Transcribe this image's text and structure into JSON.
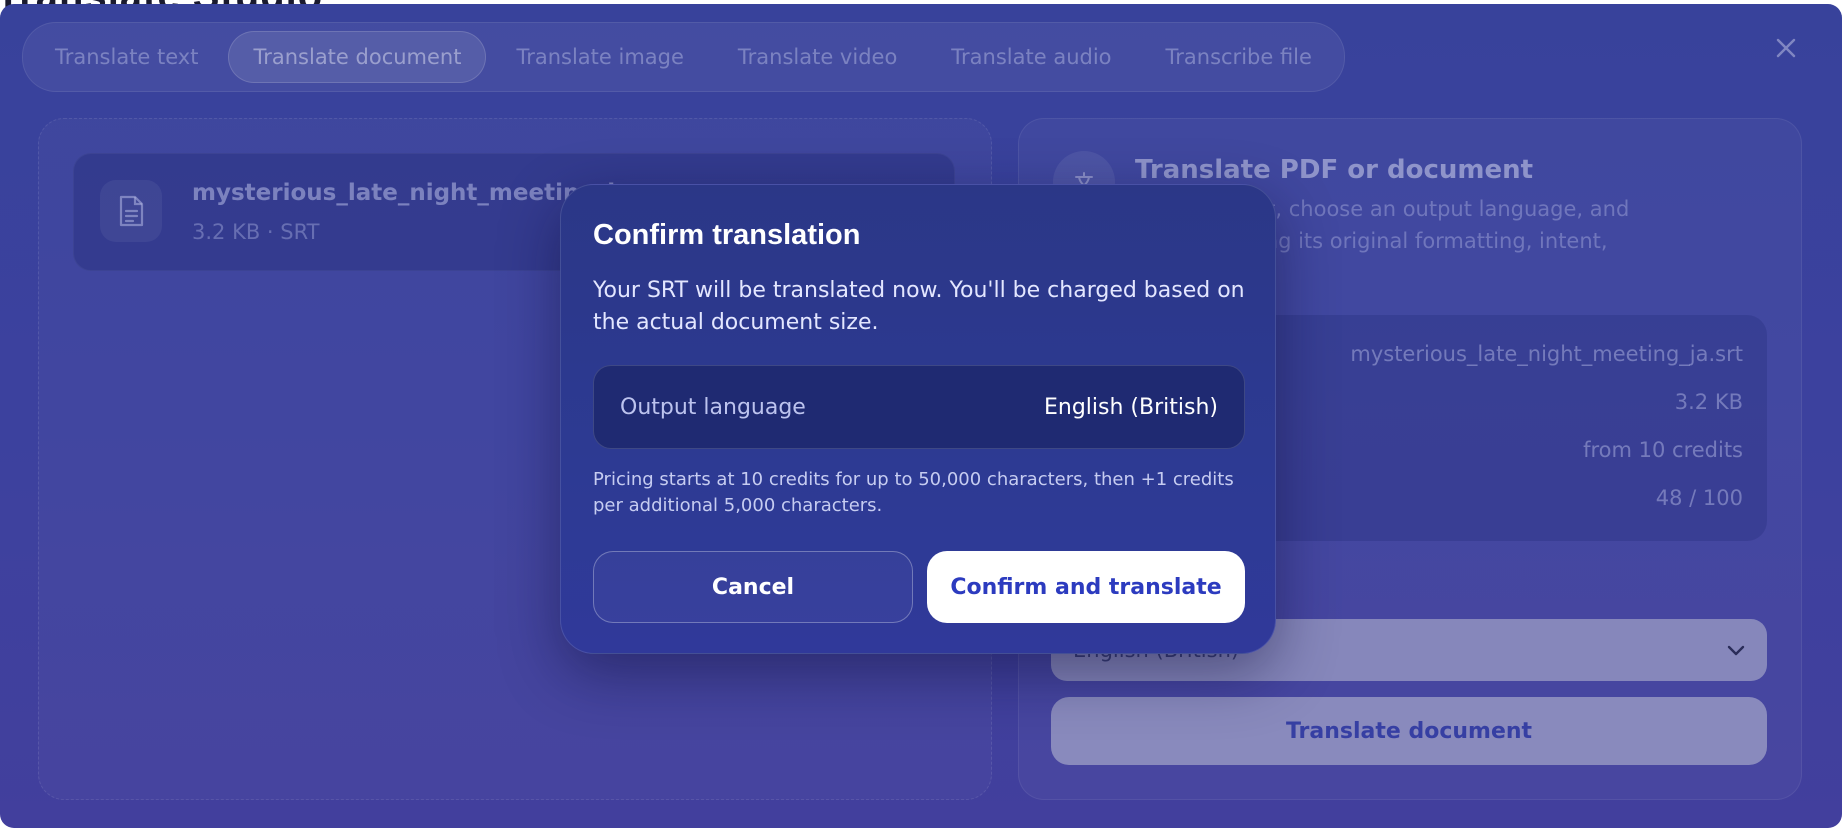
{
  "background_title": "Translate Studio",
  "tabs": [
    {
      "label": "Translate text",
      "active": false
    },
    {
      "label": "Translate document",
      "active": true
    },
    {
      "label": "Translate image",
      "active": false
    },
    {
      "label": "Translate video",
      "active": false
    },
    {
      "label": "Translate audio",
      "active": false
    },
    {
      "label": "Transcribe file",
      "active": false
    }
  ],
  "close_icon": "close-icon",
  "file": {
    "icon": "document-icon",
    "name": "mysterious_late_night_meeting_ja.s",
    "meta": "3.2 KB · SRT"
  },
  "info_panel": {
    "icon": "translate-icon",
    "title": "Translate PDF or document",
    "description": "t a document, choose an output language, and\nhile preserving its original formatting, intent,",
    "rows": [
      {
        "label": "",
        "value": "mysterious_late_night_meeting_ja.srt"
      },
      {
        "label": "",
        "value": "3.2 KB"
      },
      {
        "label": "",
        "value": "from 10 credits"
      },
      {
        "label": "g",
        "value": "48 / 100"
      }
    ],
    "select_value": "English (British)",
    "translate_button": "Translate document"
  },
  "modal": {
    "title": "Confirm translation",
    "description": "Your SRT will be translated now. You'll be charged based on the actual document size.",
    "output_language_label": "Output language",
    "output_language_value": "English (British)",
    "pricing_note": "Pricing starts at 10 credits for up to 50,000 characters, then +1 credits per additional 5,000 characters.",
    "cancel_label": "Cancel",
    "confirm_label": "Confirm and translate"
  },
  "colors": {
    "panel_bg": "#4449a9",
    "modal_bg": "#2d3a93",
    "confirm_text": "#2c3bbf"
  }
}
